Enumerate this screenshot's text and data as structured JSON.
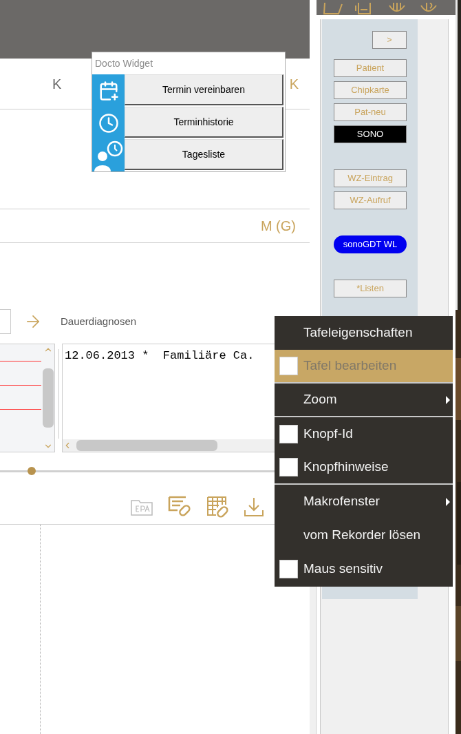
{
  "header": {
    "left_label": "K",
    "right_label": "K"
  },
  "section_label": "M (G)",
  "diagnoses": {
    "title": "Dauerdiagnosen",
    "entries": [
      "12.06.2013 *  Familiäre Ca."
    ]
  },
  "slider": {
    "level": 0.107
  },
  "widget": {
    "title": "Docto Widget",
    "buttons": [
      {
        "label": "Termin vereinbaren",
        "kind": "calendar"
      },
      {
        "label": "Terminhistorie",
        "kind": "clock"
      },
      {
        "label": "Tagesliste",
        "kind": "person"
      }
    ]
  },
  "side_panel": {
    "groups": [
      [
        {
          "label": ">",
          "kind": "small"
        }
      ],
      [
        {
          "label": "Patient",
          "kind": "normal"
        },
        {
          "label": "Chipkarte",
          "kind": "normal"
        },
        {
          "label": "Pat-neu",
          "kind": "normal"
        },
        {
          "label": "SONO",
          "kind": "dark"
        }
      ],
      [
        {
          "label": "WZ-Eintrag",
          "kind": "normal"
        },
        {
          "label": "WZ-Aufruf",
          "kind": "normal"
        }
      ],
      [
        {
          "label": "sonoGDT WL",
          "kind": "pill"
        }
      ],
      [
        {
          "label": "*Listen",
          "kind": "normal"
        }
      ]
    ]
  },
  "context_menu": {
    "items": [
      {
        "label": "Tafeleigenschaften",
        "kind": "plain",
        "highlighted": false,
        "disabled": false,
        "separator_after": false
      },
      {
        "label": "Tafel bearbeiten",
        "kind": "check",
        "checked": false,
        "highlighted": true,
        "disabled": true,
        "separator_after": true
      },
      {
        "label": "Zoom",
        "kind": "submenu",
        "highlighted": false,
        "disabled": false,
        "separator_after": true
      },
      {
        "label": "Knopf-Id",
        "kind": "check",
        "checked": false,
        "highlighted": false,
        "disabled": false,
        "separator_after": false
      },
      {
        "label": "Knopfhinweise",
        "kind": "check",
        "checked": false,
        "highlighted": false,
        "disabled": false,
        "separator_after": true
      },
      {
        "label": "Makrofenster",
        "kind": "submenu",
        "highlighted": false,
        "disabled": false,
        "separator_after": false
      },
      {
        "label": "vom Rekorder lösen",
        "kind": "plain",
        "highlighted": false,
        "disabled": false,
        "separator_after": false
      },
      {
        "label": "Maus sensitiv",
        "kind": "check",
        "checked": false,
        "highlighted": false,
        "disabled": false,
        "separator_after": false
      }
    ]
  }
}
